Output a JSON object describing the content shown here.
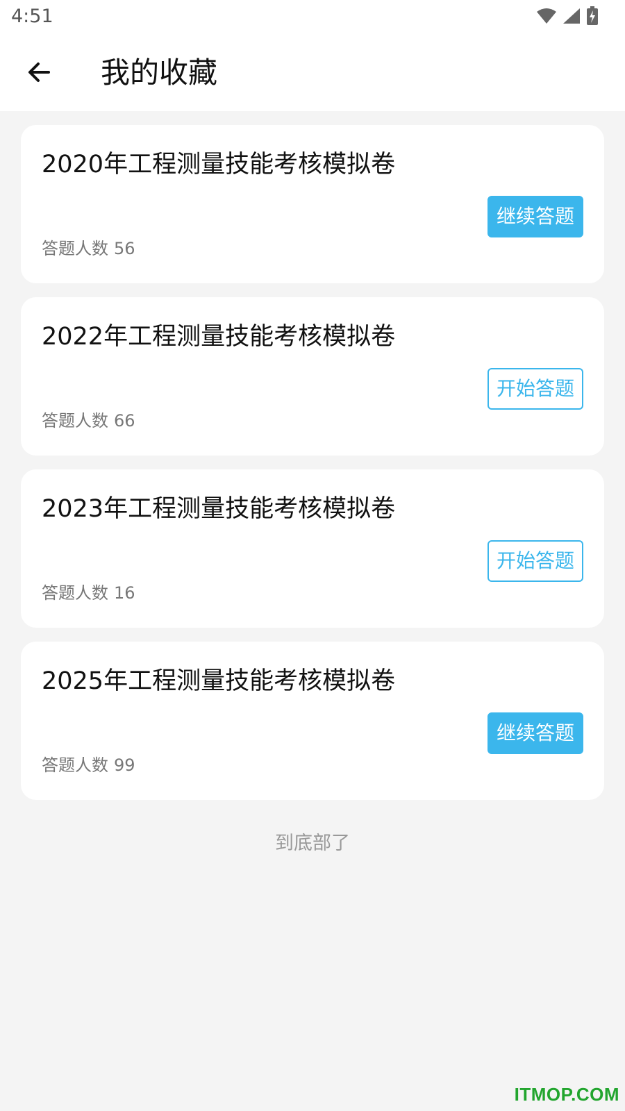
{
  "status_bar": {
    "time": "4:51",
    "icons": [
      "wifi-icon",
      "cellular-signal-icon",
      "battery-charging-icon"
    ]
  },
  "app_bar": {
    "back_icon": "arrow-left-icon",
    "title": "我的收藏"
  },
  "colors": {
    "accent": "#3bb6ec",
    "background": "#f4f4f4",
    "card": "#ffffff",
    "watermark": "#22a52e"
  },
  "cards": [
    {
      "title": "2020年工程测量技能考核模拟卷",
      "meta_label": "答题人数",
      "count": "56",
      "button_label": "继续答题",
      "button_style": "filled"
    },
    {
      "title": "2022年工程测量技能考核模拟卷",
      "meta_label": "答题人数",
      "count": "66",
      "button_label": "开始答题",
      "button_style": "outline"
    },
    {
      "title": "2023年工程测量技能考核模拟卷",
      "meta_label": "答题人数",
      "count": "16",
      "button_label": "开始答题",
      "button_style": "outline"
    },
    {
      "title": "2025年工程测量技能考核模拟卷",
      "meta_label": "答题人数",
      "count": "99",
      "button_label": "继续答题",
      "button_style": "filled"
    }
  ],
  "footer": {
    "end_text": "到底部了"
  },
  "watermark": "ITMOP.COM"
}
